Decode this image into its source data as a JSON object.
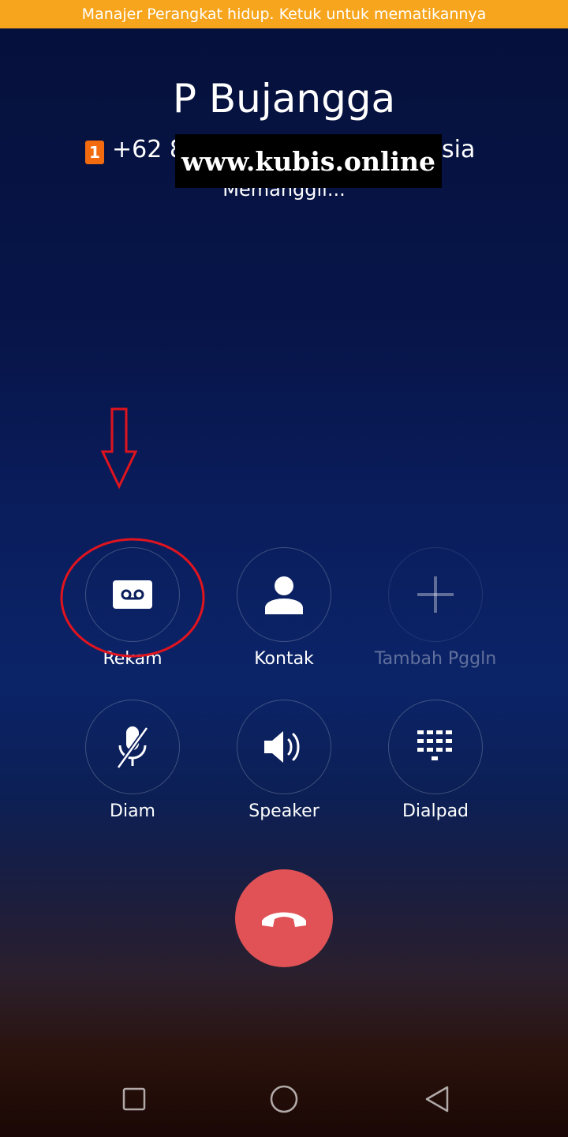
{
  "notification": {
    "text": "Manajer Perangkat hidup. Ketuk untuk mematikannya"
  },
  "call": {
    "caller_name": "P Bujangga",
    "sim_slot": "1",
    "number_prefix": "+62 8",
    "number_suffix": "sia",
    "status": "Memanggil...",
    "watermark": "www.kubis.online"
  },
  "controls": [
    {
      "label": "Rekam",
      "icon": "voicemail-icon",
      "enabled": true,
      "highlighted": true
    },
    {
      "label": "Kontak",
      "icon": "person-icon",
      "enabled": true
    },
    {
      "label": "Tambah Pggln",
      "icon": "plus-icon",
      "enabled": false
    },
    {
      "label": "Diam",
      "icon": "mic-off-icon",
      "enabled": true
    },
    {
      "label": "Speaker",
      "icon": "speaker-icon",
      "enabled": true
    },
    {
      "label": "Dialpad",
      "icon": "dialpad-icon",
      "enabled": true
    }
  ],
  "end_call": {
    "icon": "end-call-icon",
    "color": "#e05256"
  },
  "nav": {
    "recents_icon": "square-icon",
    "home_icon": "circle-icon",
    "back_icon": "triangle-back-icon"
  },
  "colors": {
    "notification": "#f7a51c",
    "sim_badge": "#f26b0f",
    "annotation": "#e0141e"
  }
}
